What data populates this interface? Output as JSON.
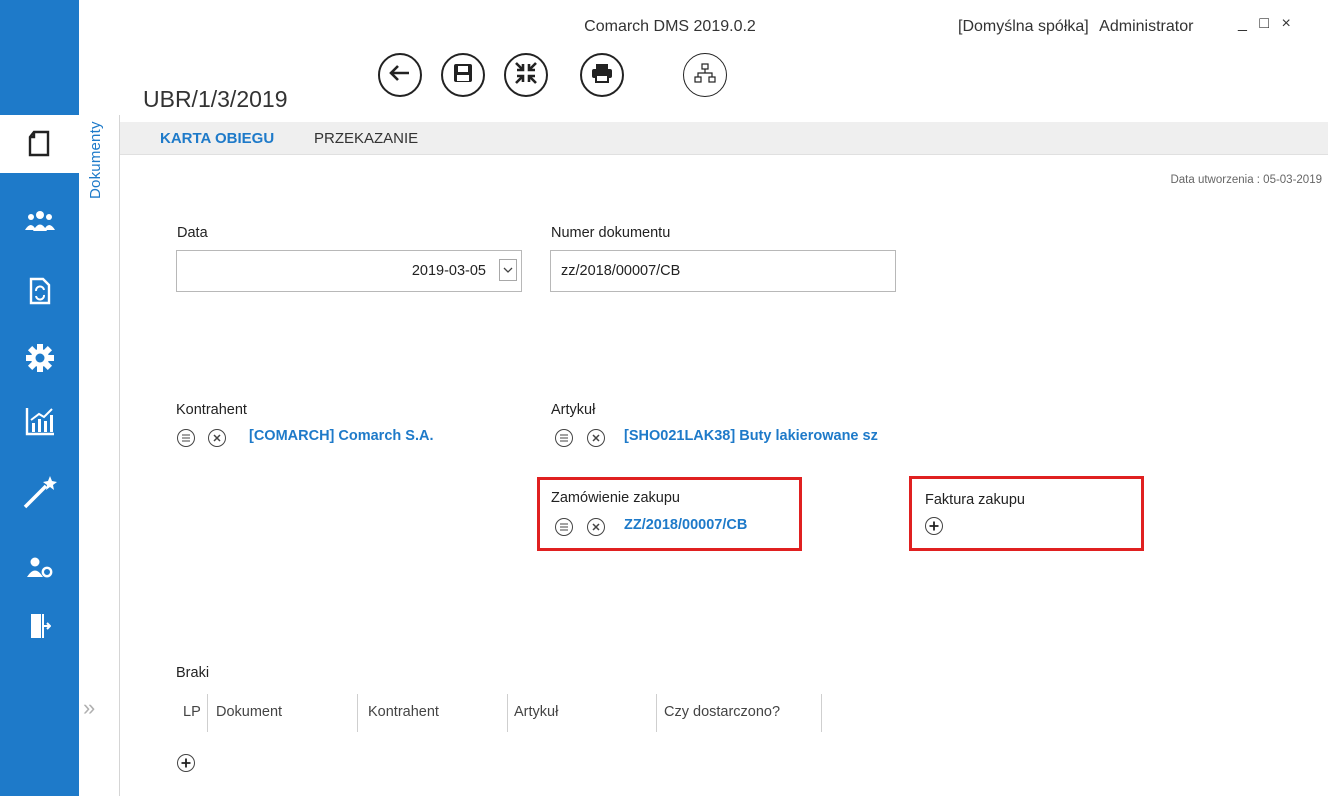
{
  "window": {
    "app_title": "Comarch DMS 2019.0.2",
    "company": "[Domyślna spółka]",
    "user": "Administrator",
    "controls": "_ □ ×"
  },
  "document": {
    "title": "UBR/1/3/2019",
    "created_label": "Data utworzenia : 05-03-2019"
  },
  "toolbar": [
    {
      "name": "back-button",
      "icon": "arrow-left-icon"
    },
    {
      "name": "save-button",
      "icon": "floppy-disk-icon"
    },
    {
      "name": "collapse-button",
      "icon": "collapse-arrows-icon"
    },
    {
      "name": "print-button",
      "icon": "printer-icon"
    },
    {
      "name": "workflow-diagram-button",
      "icon": "sitemap-icon"
    }
  ],
  "sidebar": {
    "items": [
      {
        "name": "documents",
        "icon": "documents-icon",
        "active": true
      },
      {
        "name": "users",
        "icon": "users-group-icon"
      },
      {
        "name": "workflow-document",
        "icon": "document-refresh-icon"
      },
      {
        "name": "settings",
        "icon": "gear-icon"
      },
      {
        "name": "reports",
        "icon": "bar-chart-icon"
      },
      {
        "name": "wizard",
        "icon": "magic-wand-icon"
      },
      {
        "name": "user-settings",
        "icon": "user-gear-icon"
      },
      {
        "name": "logout",
        "icon": "exit-door-icon"
      }
    ],
    "section_label": "Dokumenty",
    "expand_icon": "»"
  },
  "tabs": [
    {
      "label": "KARTA OBIEGU",
      "active": true
    },
    {
      "label": "PRZEKAZANIE",
      "active": false
    }
  ],
  "form": {
    "date": {
      "label": "Data",
      "value": "2019-03-05"
    },
    "doc_number": {
      "label": "Numer dokumentu",
      "value": "zz/2018/00007/CB"
    },
    "contractor": {
      "label": "Kontrahent",
      "value": "[COMARCH] Comarch S.A."
    },
    "article": {
      "label": "Artykuł",
      "value": "[SHO021LAK38] Buty lakierowane sz"
    },
    "purchase_order": {
      "label": "Zamówienie zakupu",
      "value": "ZZ/2018/00007/CB"
    },
    "purchase_invoice": {
      "label": "Faktura zakupu"
    }
  },
  "braki": {
    "label": "Braki",
    "columns": [
      "LP",
      "Dokument",
      "Kontrahent",
      "Artykuł",
      "Czy dostarczono?"
    ]
  },
  "colors": {
    "accent": "#1e7ac9",
    "highlight": "#e02020"
  }
}
